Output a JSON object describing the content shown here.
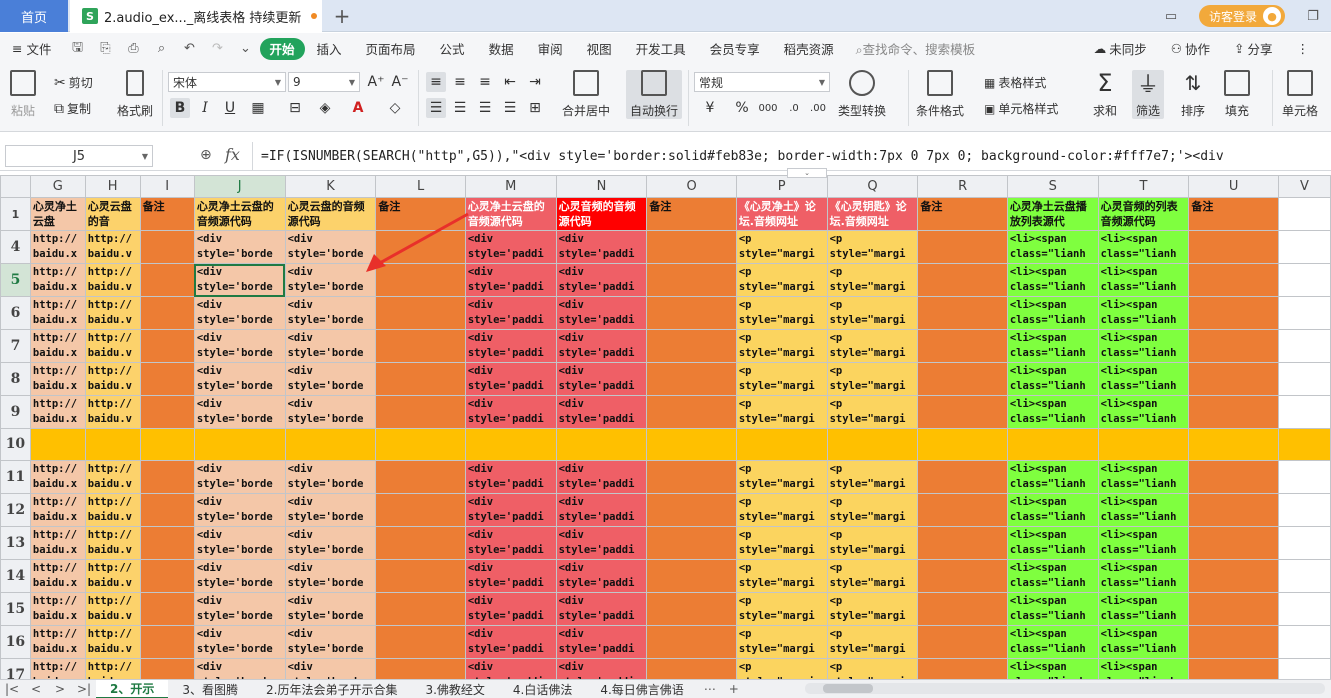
{
  "titlebar": {
    "home_tab": "首页",
    "doc_icon": "S",
    "doc_title": "2.audio_ex..._离线表格 持续更新",
    "new_tab": "+",
    "login": "访客登录"
  },
  "menu": {
    "file": "文件",
    "items": [
      "开始",
      "插入",
      "页面布局",
      "公式",
      "数据",
      "审阅",
      "视图",
      "开发工具",
      "会员专享",
      "稻壳资源"
    ],
    "search": "查找命令、搜索模板",
    "sync": "未同步",
    "collab": "协作",
    "share": "分享"
  },
  "ribbon": {
    "paste": "粘贴",
    "cut": "剪切",
    "copy": "复制",
    "format_painter": "格式刷",
    "font_name": "宋体",
    "font_size": "9",
    "merge": "合并居中",
    "wrap": "自动换行",
    "number_format": "常规",
    "convert": "类型转换",
    "cond_format": "条件格式",
    "table_style": "表格样式",
    "cell_style": "单元格样式",
    "sum": "求和",
    "filter": "筛选",
    "sort": "排序",
    "fill": "填充",
    "cell": "单元格"
  },
  "formula_bar": {
    "name_box": "J5",
    "fx": "fx",
    "formula": "=IF(ISNUMBER(SEARCH(\"http\",G5)),\"<div style='border:solid#feb83e; border-width:7px 0 7px 0; background-color:#fff7e7;'><div"
  },
  "grid": {
    "columns": [
      "G",
      "H",
      "I",
      "J",
      "K",
      "L",
      "M",
      "N",
      "O",
      "P",
      "Q",
      "R",
      "S",
      "T",
      "U",
      "V"
    ],
    "selected_column": "J",
    "selected_row": "5",
    "header_row": {
      "num": "1",
      "G": "心灵净土云盘",
      "H": "心灵云盘的音",
      "I": "备注",
      "J": "心灵净土云盘的音频源代码",
      "K": "心灵云盘的音频源代码",
      "L": "备注",
      "M": "心灵净土云盘的音频源代码",
      "N": "心灵音频的音频源代码",
      "O": "备注",
      "P": "《心灵净土》论坛.音频网址",
      "Q": "《心灵钥匙》论坛.音频网址",
      "R": "备注",
      "S": "心灵净土云盘播放列表源代",
      "T": "心灵音频的列表音频源代码",
      "U": "备注",
      "V": ""
    },
    "rows": [
      "4",
      "5",
      "6",
      "7",
      "8",
      "9",
      "10",
      "11",
      "12",
      "13",
      "14",
      "15",
      "16",
      "17"
    ],
    "band_row": "10",
    "cell_text": {
      "G": "http://\nbaidu.x",
      "H": "http://\nbaidu.v",
      "J": "<div\nstyle='borde",
      "K": "<div\nstyle='borde",
      "M": "<div\nstyle='paddi",
      "N": "<div\nstyle='paddi",
      "P": "<p\nstyle=\"margi",
      "Q": "<p\nstyle=\"margi",
      "S": "<li><span\nclass=\"lianh",
      "T": "<li><span\nclass=\"lianh"
    }
  },
  "sheet_tabs": [
    "2、开示",
    "3、看图腾",
    "2.历年法会弟子开示合集",
    "3.佛教经文",
    "4.白话佛法",
    "4.每日佛言佛语"
  ],
  "colors": {
    "accent": "#22a35c",
    "selection": "#1f7a43",
    "home_tab": "#4a7fd8"
  }
}
